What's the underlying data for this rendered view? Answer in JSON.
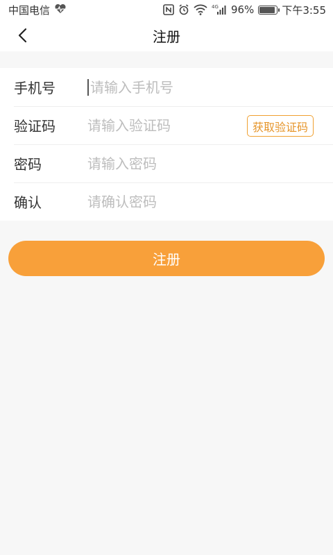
{
  "status_bar": {
    "carrier": "中国电信",
    "network": "4G",
    "battery": "96%",
    "time": "下午3:55"
  },
  "header": {
    "title": "注册"
  },
  "form": {
    "phone": {
      "label": "手机号",
      "placeholder": "请输入手机号"
    },
    "code": {
      "label": "验证码",
      "placeholder": "请输入验证码",
      "button": "获取验证码"
    },
    "password": {
      "label": "密码",
      "placeholder": "请输入密码"
    },
    "confirm": {
      "label": "确认",
      "placeholder": "请确认密码"
    }
  },
  "submit_label": "注册",
  "colors": {
    "accent": "#f8a03a",
    "code_button": "#e6952a"
  }
}
